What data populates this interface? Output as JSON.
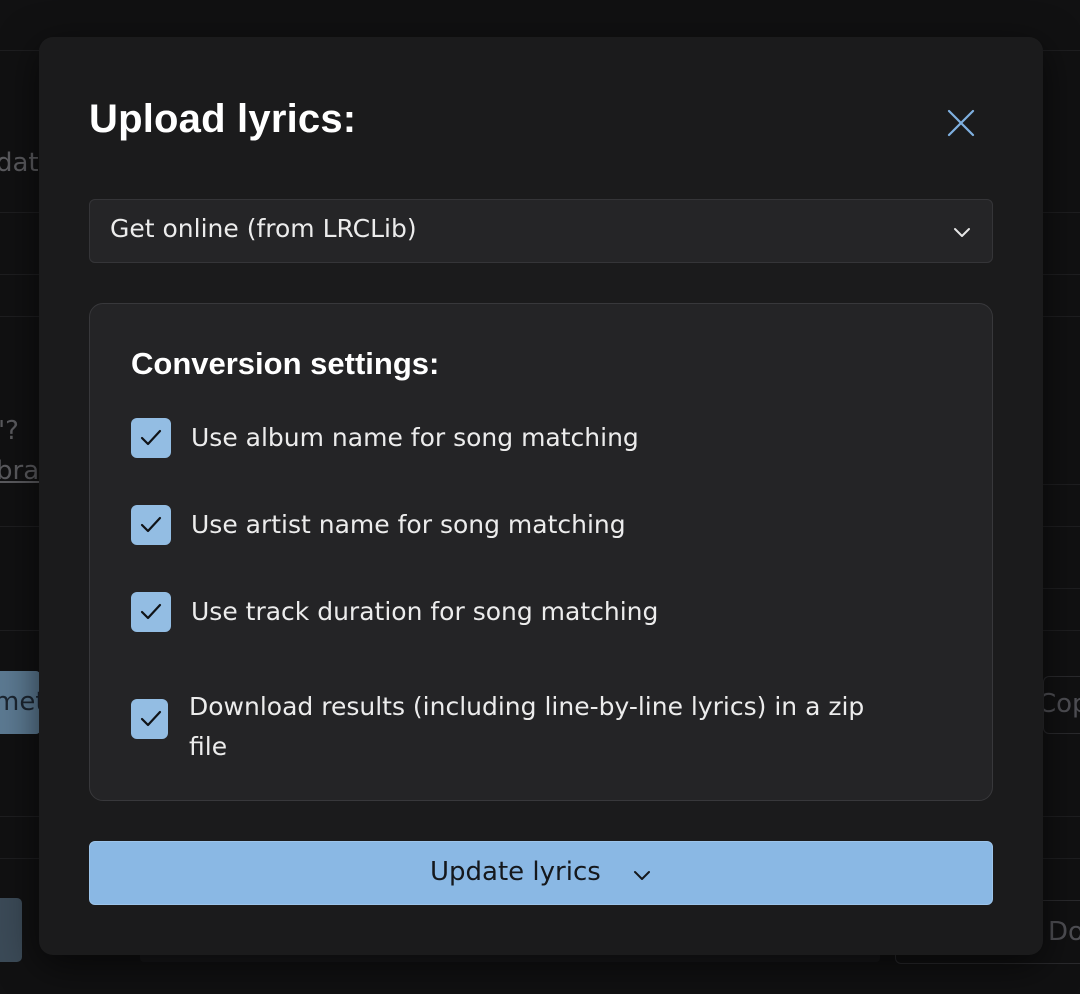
{
  "background": {
    "fragments": [
      "dat",
      "'?",
      "bra",
      "met",
      "Cop",
      "Do"
    ]
  },
  "modal": {
    "title": "Upload lyrics:",
    "close_icon": "close-icon",
    "source_select": {
      "value": "Get online (from LRCLib)",
      "icon": "chevron-down-icon"
    },
    "settings": {
      "heading": "Conversion settings:",
      "options": [
        {
          "label": "Use album name for song matching",
          "checked": true
        },
        {
          "label": "Use artist name for song matching",
          "checked": true
        },
        {
          "label": "Use track duration for song matching",
          "checked": true
        },
        {
          "label": "Download results (including line-by-line lyrics) in a zip file",
          "checked": true
        }
      ]
    },
    "primary_button": {
      "label": "Update lyrics",
      "icon": "chevron-down-icon"
    }
  },
  "colors": {
    "accent": "#8ab8e4",
    "checkbox": "#93bde3",
    "close_icon": "#7fb0e0",
    "modal_bg": "#1b1b1c",
    "panel_bg": "#242426"
  }
}
